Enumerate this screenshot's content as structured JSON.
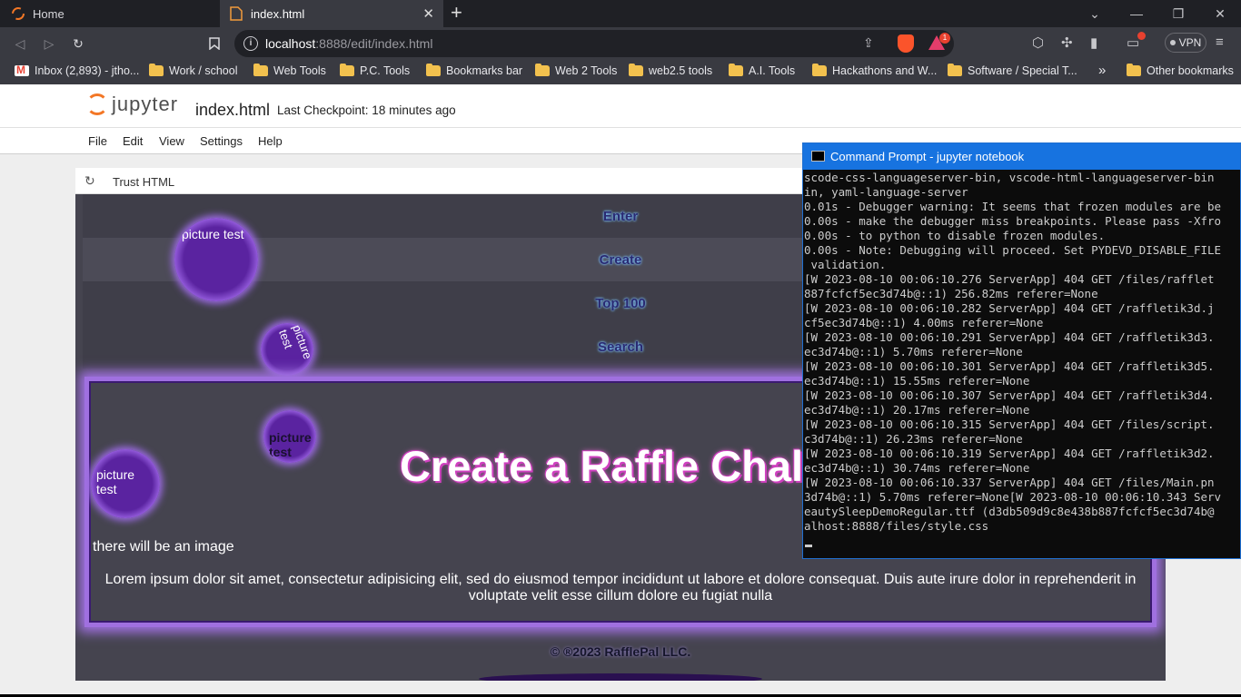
{
  "browser": {
    "tabs": [
      {
        "label": "Home"
      },
      {
        "label": "index.html"
      }
    ],
    "url": {
      "host": "localhost",
      "rest": ":8888/edit/index.html"
    },
    "rewards_count": "1",
    "vpn_label": "VPN",
    "bookmarks": [
      {
        "label": "Inbox (2,893) - jtho..."
      },
      {
        "label": "Work / school"
      },
      {
        "label": "Web Tools"
      },
      {
        "label": "P.C. Tools"
      },
      {
        "label": "Bookmarks bar"
      },
      {
        "label": "Web 2 Tools"
      },
      {
        "label": "web2.5 tools"
      },
      {
        "label": "A.I. Tools"
      },
      {
        "label": "Hackathons and W..."
      },
      {
        "label": "Software / Special T..."
      },
      {
        "label": "Other bookmarks"
      }
    ],
    "bookmarks_overflow": "»"
  },
  "jupyter": {
    "logo_text": "jupyter",
    "filename": "index.html",
    "checkpoint": "Last Checkpoint: 18 minutes ago",
    "menu": [
      "File",
      "Edit",
      "View",
      "Settings",
      "Help"
    ],
    "trust_label": "Trust HTML"
  },
  "preview": {
    "nav": [
      "Enter",
      "Create",
      "Top 100",
      "Search"
    ],
    "hero_title": "Create a Raffle Challenge",
    "image_note": "there will be an image",
    "lorem": "Lorem ipsum dolor sit amet, consectetur adipisicing elit, sed do eiusmod tempor incididunt ut labore et dolore consequat. Duis aute irure dolor in reprehenderit in voluptate velit esse cillum dolore eu fugiat nulla",
    "bubbles": [
      "picture test",
      "picture test",
      "picture test",
      "picture test"
    ],
    "footer": "© ®2023 RafflePal LLC."
  },
  "terminal": {
    "title": "Command Prompt - jupyter  notebook",
    "lines": [
      "scode-css-languageserver-bin, vscode-html-languageserver-bin",
      "in, yaml-language-server",
      "0.01s - Debugger warning: It seems that frozen modules are be",
      "0.00s - make the debugger miss breakpoints. Please pass -Xfro",
      "0.00s - to python to disable frozen modules.",
      "0.00s - Note: Debugging will proceed. Set PYDEVD_DISABLE_FILE",
      " validation.",
      "[W 2023-08-10 00:06:10.276 ServerApp] 404 GET /files/rafflet",
      "887fcfcf5ec3d74b@::1) 256.82ms referer=None",
      "[W 2023-08-10 00:06:10.282 ServerApp] 404 GET /raffletik3d.j",
      "cf5ec3d74b@::1) 4.00ms referer=None",
      "[W 2023-08-10 00:06:10.291 ServerApp] 404 GET /raffletik3d3.",
      "ec3d74b@::1) 5.70ms referer=None",
      "[W 2023-08-10 00:06:10.301 ServerApp] 404 GET /raffletik3d5.",
      "ec3d74b@::1) 15.55ms referer=None",
      "[W 2023-08-10 00:06:10.307 ServerApp] 404 GET /raffletik3d4.",
      "ec3d74b@::1) 20.17ms referer=None",
      "[W 2023-08-10 00:06:10.315 ServerApp] 404 GET /files/script.",
      "c3d74b@::1) 26.23ms referer=None",
      "[W 2023-08-10 00:06:10.319 ServerApp] 404 GET /raffletik3d2.",
      "ec3d74b@::1) 30.74ms referer=None",
      "[W 2023-08-10 00:06:10.337 ServerApp] 404 GET /files/Main.pn",
      "3d74b@::1) 5.70ms referer=None[W 2023-08-10 00:06:10.343 Serv",
      "eautySleepDemoRegular.ttf (d3db509d9c8e438b887fcfcf5ec3d74b@",
      "alhost:8888/files/style.css"
    ]
  },
  "colors": {
    "preview_bg": "#45444f",
    "accent_purple": "#a070e0",
    "title_glow": "#d040c0",
    "cmd_titlebar": "#1773e0"
  }
}
